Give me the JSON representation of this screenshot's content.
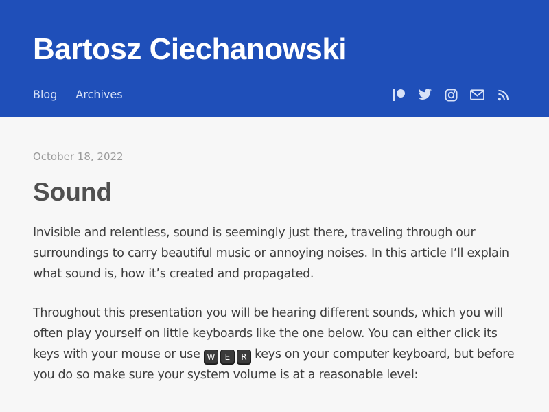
{
  "header": {
    "site_title": "Bartosz Ciechanowski",
    "nav": [
      {
        "label": "Blog"
      },
      {
        "label": "Archives"
      }
    ],
    "social_icons": [
      "patreon-icon",
      "twitter-icon",
      "instagram-icon",
      "mail-icon",
      "rss-icon"
    ],
    "background_color": "#1f4fb9"
  },
  "post": {
    "date": "October 18, 2022",
    "title": "Sound",
    "paragraph_1": "Invisible and relentless, sound is seemingly just there, traveling through our surroundings to carry beautiful music or annoying noises. In this article I’ll explain what sound is, how it’s created and propagated.",
    "paragraph_2_before": "Throughout this presentation you will be hearing different sounds, which you will often play yourself on little keyboards like the one below. You can either click its keys with your mouse or use",
    "paragraph_2_after": "keys on your computer keyboard, but before you do so make sure your system volume is at a reasonable level:",
    "keys": [
      "W",
      "E",
      "R"
    ]
  }
}
